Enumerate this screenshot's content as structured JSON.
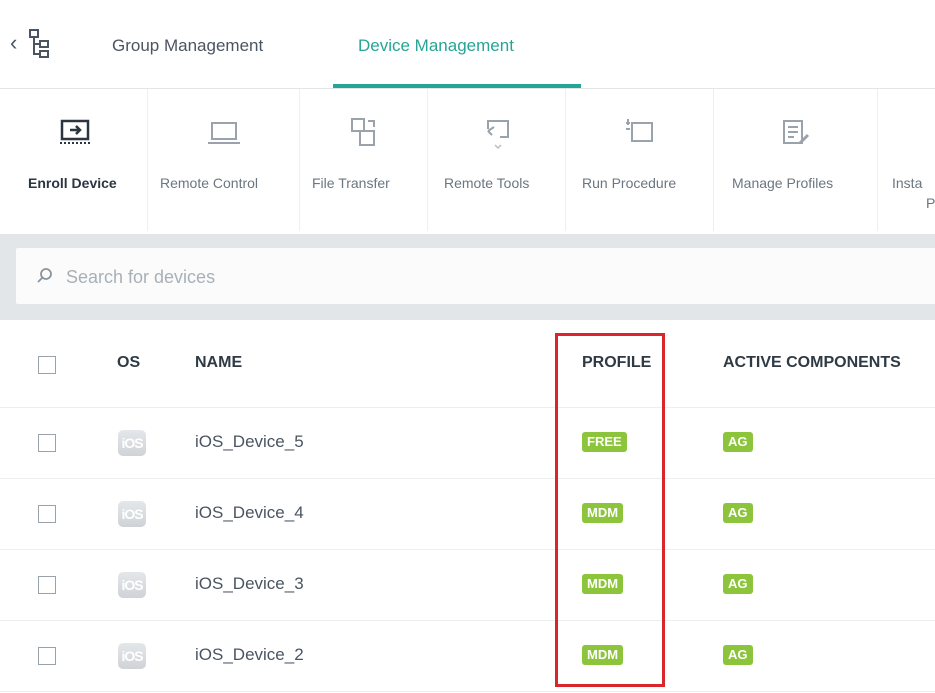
{
  "tabs": {
    "group": "Group Management",
    "device": "Device Management"
  },
  "toolbar": {
    "items": [
      {
        "label": "Enroll Device",
        "icon": "enroll-device-icon"
      },
      {
        "label": "Remote Control",
        "icon": "monitor-icon"
      },
      {
        "label": "File Transfer",
        "icon": "file-transfer-icon"
      },
      {
        "label": "Remote Tools",
        "icon": "remote-tools-icon"
      },
      {
        "label": "Run Procedure",
        "icon": "run-procedure-icon"
      },
      {
        "label": "Manage Profiles",
        "icon": "manage-profiles-icon"
      },
      {
        "label": "Insta",
        "sublabel": "P",
        "icon": "install-icon"
      }
    ]
  },
  "search": {
    "placeholder": "Search for devices"
  },
  "table": {
    "headers": {
      "os": "OS",
      "name": "NAME",
      "profile": "PROFILE",
      "active_components": "ACTIVE COMPONENTS"
    },
    "rows": [
      {
        "os": "iOS",
        "name": "iOS_Device_5",
        "profile": "FREE",
        "component": "AG"
      },
      {
        "os": "iOS",
        "name": "iOS_Device_4",
        "profile": "MDM",
        "component": "AG"
      },
      {
        "os": "iOS",
        "name": "iOS_Device_3",
        "profile": "MDM",
        "component": "AG"
      },
      {
        "os": "iOS",
        "name": "iOS_Device_2",
        "profile": "MDM",
        "component": "AG"
      }
    ]
  },
  "colors": {
    "accent": "#26a594",
    "badge": "#8cc43c",
    "highlight": "#d9262c"
  }
}
